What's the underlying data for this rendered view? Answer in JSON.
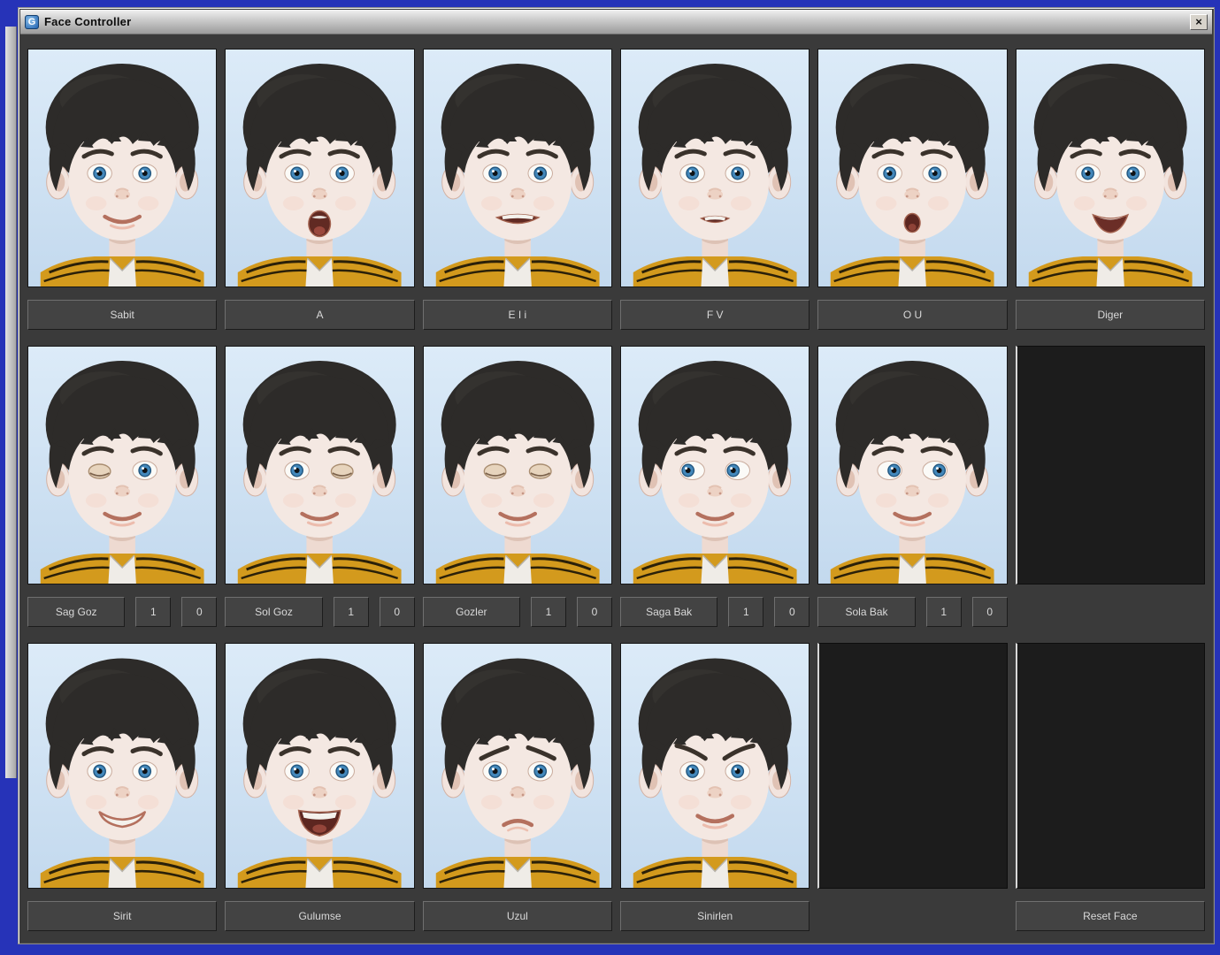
{
  "titlebar": {
    "title": "Face Controller",
    "app_icon_glyph": "G",
    "close_glyph": "×"
  },
  "cells": {
    "r1c1": {
      "label": "Sabit",
      "eyes": "open",
      "mouth": "smile",
      "brows": "normal"
    },
    "r1c2": {
      "label": "A",
      "eyes": "open",
      "mouth": "open_a",
      "brows": "normal"
    },
    "r1c3": {
      "label": "E I i",
      "eyes": "open",
      "mouth": "ee",
      "brows": "normal"
    },
    "r1c4": {
      "label": "F V",
      "eyes": "open",
      "mouth": "fv",
      "brows": "normal"
    },
    "r1c5": {
      "label": "O U",
      "eyes": "open",
      "mouth": "oo",
      "brows": "normal"
    },
    "r1c6": {
      "label": "Diger",
      "eyes": "open",
      "mouth": "smile_open",
      "brows": "normal"
    },
    "r2c1": {
      "label": "Sag Goz",
      "one": "1",
      "zero": "0",
      "eyes": "wink_left",
      "mouth": "smile",
      "brows": "normal"
    },
    "r2c2": {
      "label": "Sol Goz",
      "one": "1",
      "zero": "0",
      "eyes": "wink_right",
      "mouth": "smile",
      "brows": "normal"
    },
    "r2c3": {
      "label": "Gozler",
      "one": "1",
      "zero": "0",
      "eyes": "closed",
      "mouth": "smile",
      "brows": "normal"
    },
    "r2c4": {
      "label": "Saga Bak",
      "one": "1",
      "zero": "0",
      "eyes": "look_left",
      "mouth": "smile",
      "brows": "normal"
    },
    "r2c5": {
      "label": "Sola Bak",
      "one": "1",
      "zero": "0",
      "eyes": "look_right",
      "mouth": "smile",
      "brows": "normal"
    },
    "r3c1": {
      "label": "Sirit",
      "eyes": "open",
      "mouth": "grin",
      "brows": "normal"
    },
    "r3c2": {
      "label": "Gulumse",
      "eyes": "open",
      "mouth": "big_smile",
      "brows": "normal"
    },
    "r3c3": {
      "label": "Uzul",
      "eyes": "open",
      "mouth": "sad",
      "brows": "sad"
    },
    "r3c4": {
      "label": "Sinirlen",
      "eyes": "open",
      "mouth": "smile",
      "brows": "angry"
    },
    "reset": {
      "label": "Reset Face"
    }
  },
  "colors": {
    "desktop_blue": "#2633b8",
    "panel_gray": "#3a3a3a",
    "thumb_blue": "#cfe2f4",
    "collar_mustard": "#d39a1d"
  }
}
